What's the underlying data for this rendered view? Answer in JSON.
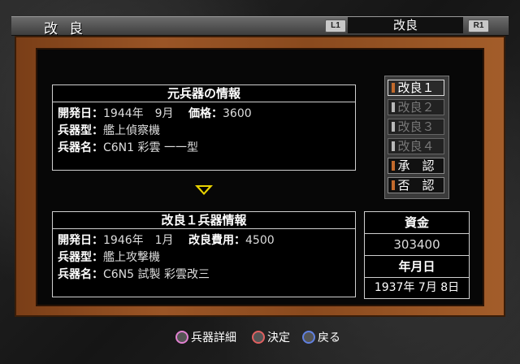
{
  "screen_title": "改良",
  "tab": {
    "left_button": "L1",
    "label": "改良",
    "right_button": "R1"
  },
  "original": {
    "heading": "元兵器の情報",
    "dev_date_label": "開発日：",
    "dev_date_value": "1944年　9月",
    "price_label": "価格：",
    "price_value": "3600",
    "type_label": "兵器型：",
    "type_value": "艦上偵察機",
    "name_label": "兵器名：",
    "name_value": "C6N1 彩雲 一一型"
  },
  "improved": {
    "heading": "改良１兵器情報",
    "dev_date_label": "開発日：",
    "dev_date_value": "1946年　1月",
    "cost_label": "改良費用：",
    "cost_value": "4500",
    "type_label": "兵器型：",
    "type_value": "艦上攻撃機",
    "name_label": "兵器名：",
    "name_value": "C6N5 試製 彩雲改三"
  },
  "side_menu": [
    {
      "label": "改良１",
      "state": "selected"
    },
    {
      "label": "改良２",
      "state": "disabled"
    },
    {
      "label": "改良３",
      "state": "disabled"
    },
    {
      "label": "改良４",
      "state": "disabled"
    },
    {
      "label": "承　認",
      "state": "enabled"
    },
    {
      "label": "否　認",
      "state": "enabled"
    }
  ],
  "funds": {
    "funds_label": "資金",
    "funds_value": "303400",
    "date_label": "年月日",
    "date_value": "1937年 7月  8日"
  },
  "hints": [
    {
      "icon": "square-button-icon",
      "color": "#e080d0",
      "label": "兵器詳細"
    },
    {
      "icon": "circle-button-icon",
      "color": "#e06060",
      "label": "決定"
    },
    {
      "icon": "cross-button-icon",
      "color": "#6080e0",
      "label": "戻る"
    }
  ]
}
